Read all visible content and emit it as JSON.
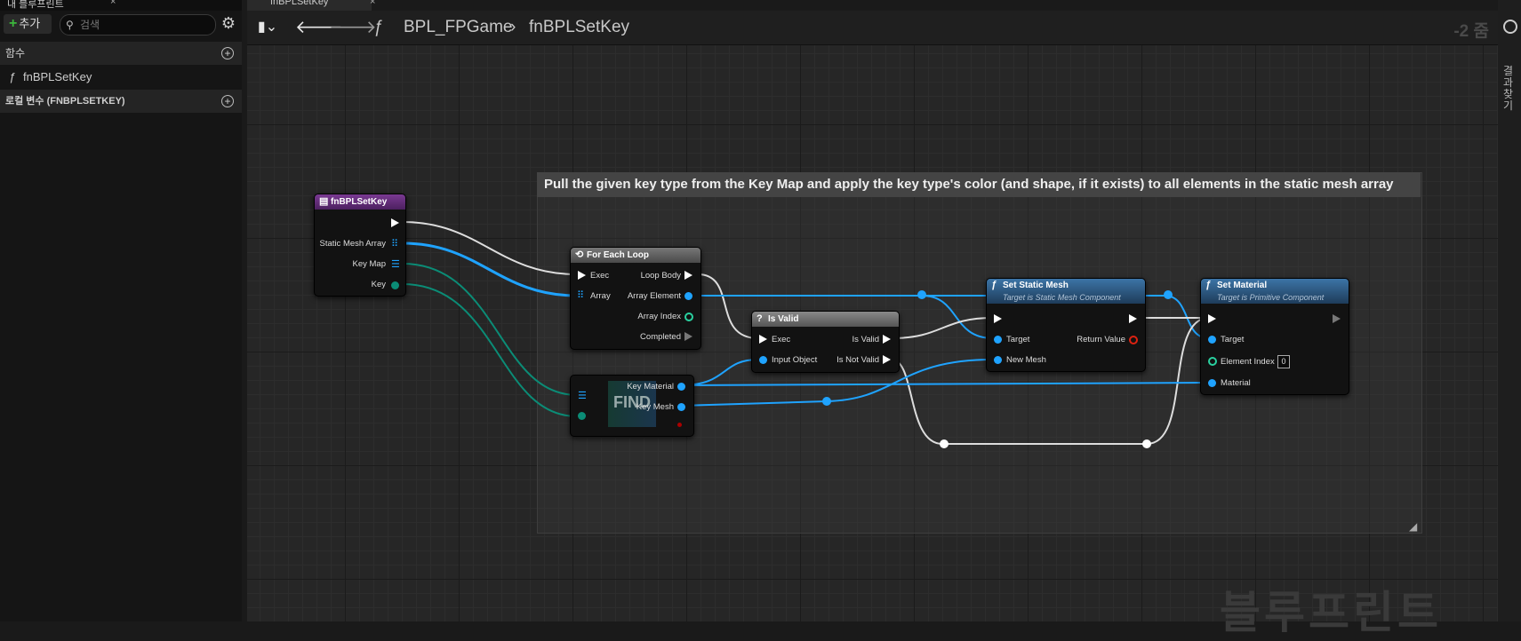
{
  "left_panel": {
    "tab_title": "내 블루프린트",
    "add_label": "추가",
    "search_placeholder": "검색",
    "functions_header": "함수",
    "function_item": "fnBPLSetKey",
    "local_vars_header": "로컬 변수 (FNBPLSETKEY)"
  },
  "graph_tab": {
    "title": "fnBPLSetKey"
  },
  "breadcrumb": {
    "blueprint": "BPL_FPGame",
    "function": "fnBPLSetKey"
  },
  "zoom_label": "-2 줌",
  "right_panel": {
    "vertical_text": "결과 찾기"
  },
  "watermark": "블루프린트",
  "comment": {
    "text": "Pull the given key type from the Key Map and apply the key type's color (and shape, if it exists) to all elements in the static mesh array"
  },
  "nodes": {
    "entry": {
      "title": "fnBPLSetKey",
      "pins": [
        "Static Mesh Array",
        "Key Map",
        "Key"
      ]
    },
    "foreach": {
      "title": "For Each Loop",
      "inputs": [
        "Exec",
        "Array"
      ],
      "outputs": [
        "Loop Body",
        "Array Element",
        "Array Index",
        "Completed"
      ]
    },
    "isvalid": {
      "title": "Is Valid",
      "inputs": [
        "Exec",
        "Input Object"
      ],
      "outputs": [
        "Is Valid",
        "Is Not Valid"
      ]
    },
    "find": {
      "label": "FIND",
      "outputs": [
        "Key Material",
        "Key Mesh"
      ]
    },
    "setmesh": {
      "title": "Set Static Mesh",
      "subtitle": "Target is Static Mesh Component",
      "inputs": [
        "Target",
        "New Mesh"
      ],
      "outputs": [
        "Return Value"
      ]
    },
    "setmat": {
      "title": "Set Material",
      "subtitle": "Target is Primitive Component",
      "inputs": [
        "Target",
        "Element Index",
        "Material"
      ],
      "element_index_value": "0"
    }
  },
  "colors": {
    "object_pin": "#1fa3ff",
    "struct_pin": "#0b8c76",
    "exec_pin": "#ffffff",
    "function_header": "#2b5a86",
    "entry_header": "#6a2f80"
  }
}
